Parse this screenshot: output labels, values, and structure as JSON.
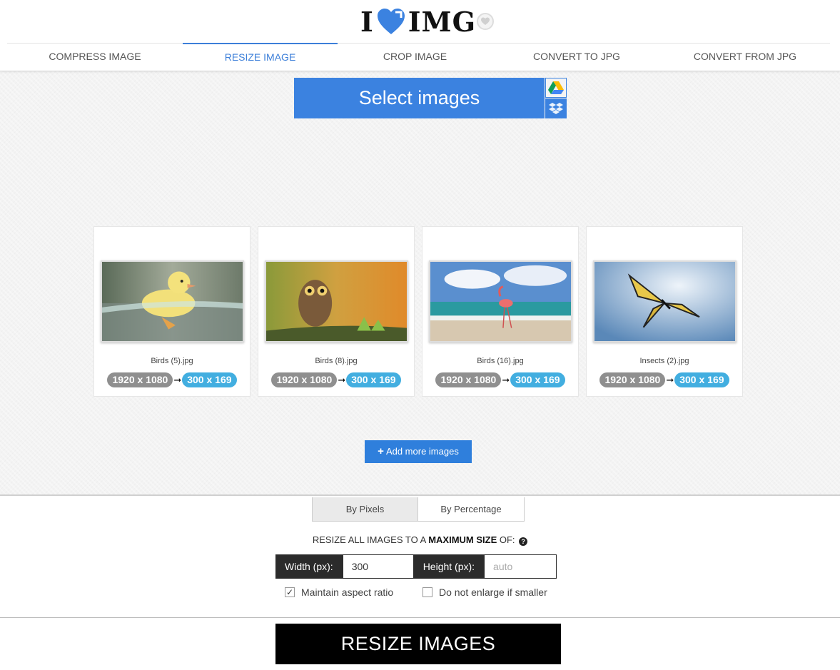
{
  "logo": {
    "text_left": "I",
    "text_right": "IMG",
    "heart_icon": "heart-icon",
    "badge_icon": "heart-badge-icon"
  },
  "colors": {
    "accent": "#3b82e0",
    "pill_gray": "#8f8f8f",
    "pill_blue": "#42aee0",
    "dark": "#2b2b2b"
  },
  "nav": {
    "items": [
      {
        "label": "COMPRESS IMAGE",
        "active": false
      },
      {
        "label": "RESIZE IMAGE",
        "active": true
      },
      {
        "label": "CROP IMAGE",
        "active": false
      },
      {
        "label": "CONVERT TO JPG",
        "active": false
      },
      {
        "label": "CONVERT FROM JPG",
        "active": false
      }
    ]
  },
  "upload": {
    "select_label": "Select images",
    "drive_icon": "google-drive-icon",
    "dropbox_icon": "dropbox-icon",
    "add_more_label": "Add more images"
  },
  "images": [
    {
      "filename": "Birds (5).jpg",
      "original": "1920 x 1080",
      "resized": "300 x 169"
    },
    {
      "filename": "Birds (8).jpg",
      "original": "1920 x 1080",
      "resized": "300 x 169"
    },
    {
      "filename": "Birds (16).jpg",
      "original": "1920 x 1080",
      "resized": "300 x 169"
    },
    {
      "filename": "Insects (2).jpg",
      "original": "1920 x 1080",
      "resized": "300 x 169"
    }
  ],
  "options": {
    "tabs": [
      {
        "label": "By Pixels",
        "active": true
      },
      {
        "label": "By Percentage",
        "active": false
      }
    ],
    "resize_prefix": "RESIZE ALL IMAGES TO A ",
    "resize_bold": "MAXIMUM SIZE",
    "resize_suffix": " OF:",
    "width_label": "Width (px):",
    "width_value": "300",
    "height_label": "Height (px):",
    "height_placeholder": "auto",
    "maintain_label": "Maintain aspect ratio",
    "maintain_checked": true,
    "enlarge_label": "Do not enlarge if smaller",
    "enlarge_checked": false,
    "submit_label": "RESIZE IMAGES"
  }
}
